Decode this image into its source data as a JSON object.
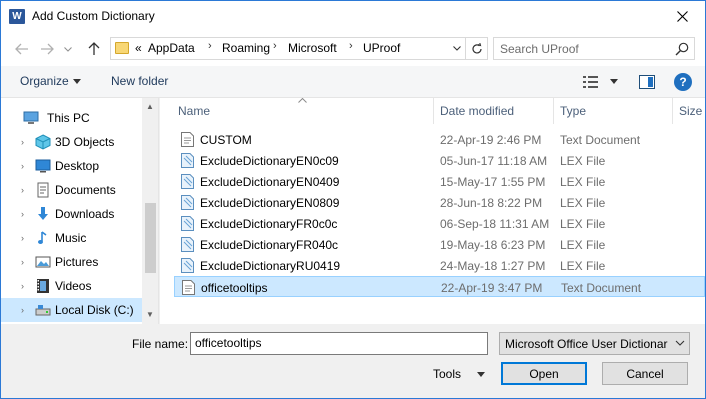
{
  "window": {
    "title": "Add Custom Dictionary",
    "app_icon": "word-icon"
  },
  "address": {
    "overflow": "«",
    "segments": [
      "AppData",
      "Roaming",
      "Microsoft",
      "UProof"
    ]
  },
  "search": {
    "placeholder": "Search UProof"
  },
  "toolbar": {
    "organize": "Organize",
    "new_folder": "New folder",
    "help": "?"
  },
  "nav": {
    "items": [
      {
        "label": "This PC",
        "icon": "computer-icon",
        "expander": ""
      },
      {
        "label": "3D Objects",
        "icon": "cube-icon",
        "expander": "›"
      },
      {
        "label": "Desktop",
        "icon": "desktop-icon",
        "expander": "›"
      },
      {
        "label": "Documents",
        "icon": "documents-icon",
        "expander": "›"
      },
      {
        "label": "Downloads",
        "icon": "download-icon",
        "expander": "›"
      },
      {
        "label": "Music",
        "icon": "music-icon",
        "expander": "›"
      },
      {
        "label": "Pictures",
        "icon": "pictures-icon",
        "expander": "›"
      },
      {
        "label": "Videos",
        "icon": "videos-icon",
        "expander": "›"
      },
      {
        "label": "Local Disk (C:)",
        "icon": "drive-icon",
        "expander": "›"
      }
    ]
  },
  "columns": {
    "name": "Name",
    "date": "Date modified",
    "type": "Type",
    "size": "Size"
  },
  "files": [
    {
      "name": "CUSTOM",
      "date": "22-Apr-19 2:46 PM",
      "type": "Text Document",
      "icon": "text-file-icon"
    },
    {
      "name": "ExcludeDictionaryEN0c09",
      "date": "05-Jun-17 11:18 AM",
      "type": "LEX File",
      "icon": "lex-file-icon"
    },
    {
      "name": "ExcludeDictionaryEN0409",
      "date": "15-May-17 1:55 PM",
      "type": "LEX File",
      "icon": "lex-file-icon"
    },
    {
      "name": "ExcludeDictionaryEN0809",
      "date": "28-Jun-18 8:22 PM",
      "type": "LEX File",
      "icon": "lex-file-icon"
    },
    {
      "name": "ExcludeDictionaryFR0c0c",
      "date": "06-Sep-18 11:31 AM",
      "type": "LEX File",
      "icon": "lex-file-icon"
    },
    {
      "name": "ExcludeDictionaryFR040c",
      "date": "19-May-18 6:23 PM",
      "type": "LEX File",
      "icon": "lex-file-icon"
    },
    {
      "name": "ExcludeDictionaryRU0419",
      "date": "24-May-18 1:27 PM",
      "type": "LEX File",
      "icon": "lex-file-icon"
    },
    {
      "name": "officetooltips",
      "date": "22-Apr-19 3:47 PM",
      "type": "Text Document",
      "icon": "text-file-icon"
    }
  ],
  "bottom": {
    "file_name_label": "File name:",
    "file_name_value": "officetooltips",
    "file_type": "Microsoft Office User Dictionar",
    "tools": "Tools",
    "open": "Open",
    "cancel": "Cancel"
  },
  "colors": {
    "accent": "#0078d7",
    "selection": "#cce8ff",
    "title_border": "#2b79d6"
  }
}
